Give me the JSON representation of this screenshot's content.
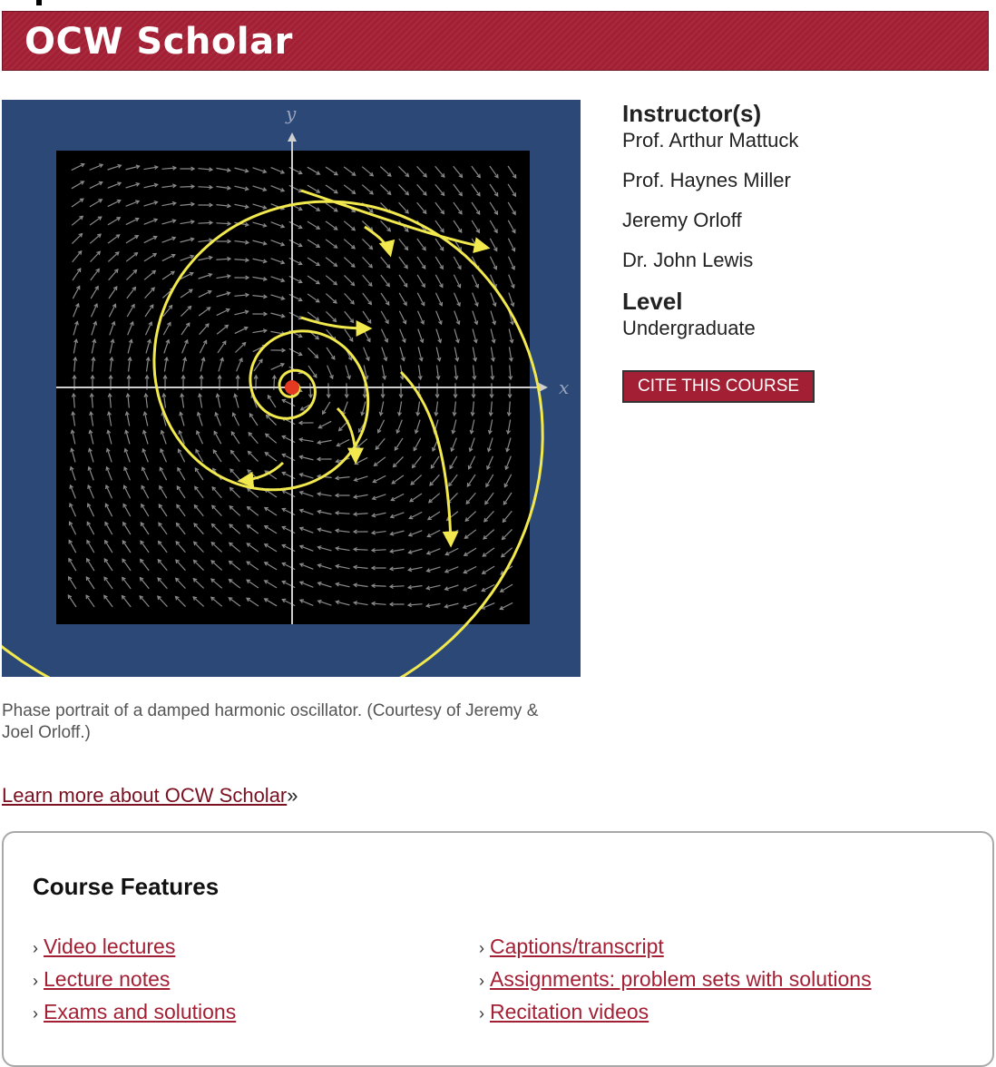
{
  "banner": {
    "title": "OCW Scholar"
  },
  "figure": {
    "x_label": "x",
    "y_label": "y",
    "caption": "Phase portrait of a damped harmonic oscillator. (Courtesy of Jeremy & Joel Orloff.)"
  },
  "learn": {
    "link": "Learn more about OCW Scholar",
    "suffix": "»"
  },
  "sidebar": {
    "instructors_heading": "Instructor(s)",
    "instructors": [
      "Prof. Arthur Mattuck",
      "Prof. Haynes Miller",
      "Jeremy Orloff",
      "Dr. John Lewis"
    ],
    "level_heading": "Level",
    "level": "Undergraduate",
    "cite_button": "CITE THIS COURSE"
  },
  "features": {
    "heading": "Course Features",
    "col1": [
      "Video lectures",
      "Lecture notes",
      "Exams and solutions"
    ],
    "col2": [
      "Captions/transcript",
      "Assignments: problem sets with solutions",
      "Recitation videos"
    ]
  }
}
